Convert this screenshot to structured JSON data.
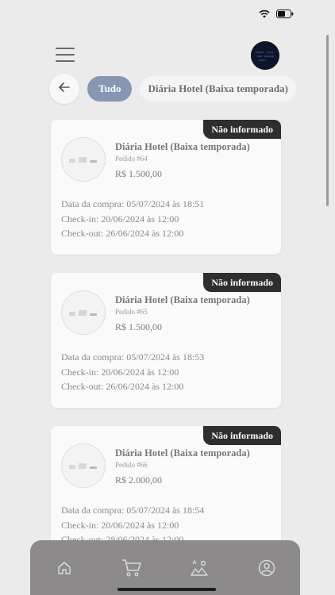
{
  "header": {
    "menu_icon": "menu-icon",
    "avatar_icon": "avatar"
  },
  "filters": {
    "back_icon": "arrow-left-icon",
    "all_label": "Tudo",
    "chip_label": "Diária Hotel (Baixa temporada)"
  },
  "orders": [
    {
      "status": "Não informado",
      "title": "Diária Hotel (Baixa temporada)",
      "order": "Pedido #64",
      "price": "R$ 1.500,00",
      "purchase": "Data da compra: 05/07/2024 às 18:51",
      "checkin": "Check-in: 20/06/2024 às 12:00",
      "checkout": "Check-out: 26/06/2024 às 12:00"
    },
    {
      "status": "Não informado",
      "title": "Diária Hotel (Baixa temporada)",
      "order": "Pedido #65",
      "price": "R$ 1.500,00",
      "purchase": "Data da compra: 05/07/2024 às 18:53",
      "checkin": "Check-in: 20/06/2024 às 12:00",
      "checkout": "Check-out: 26/06/2024 às 12:00"
    },
    {
      "status": "Não informado",
      "title": "Diária Hotel (Baixa temporada)",
      "order": "Pedido #66",
      "price": "R$ 2.000,00",
      "purchase": "Data da compra: 05/07/2024 às 18:54",
      "checkin": "Check-in: 20/06/2024 às 12:00",
      "checkout": "Check-out: 28/06/2024 às 12:00"
    }
  ],
  "nav": [
    "home-icon",
    "cart-icon",
    "trips-icon",
    "profile-icon"
  ],
  "colors": {
    "accent": "#8696b3",
    "badge": "#2e2e30",
    "nav": "#8d8a8b",
    "background": "#ecebec"
  }
}
